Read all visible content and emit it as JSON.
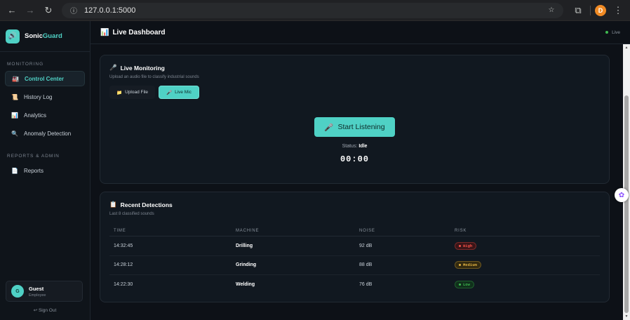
{
  "browser": {
    "url": "127.0.0.1:5000",
    "profile_initial": "D"
  },
  "sidebar": {
    "brand": {
      "name_part1": "Sonic",
      "name_part2": "Guard",
      "logo_icon": "speaker-icon"
    },
    "sections": [
      {
        "label": "MONITORING",
        "items": [
          {
            "label": "Control Center",
            "icon": "🏭",
            "active": true
          },
          {
            "label": "History Log",
            "icon": "📜",
            "active": false
          },
          {
            "label": "Analytics",
            "icon": "📊",
            "active": false
          },
          {
            "label": "Anomaly Detection",
            "icon": "🔍",
            "active": false
          }
        ]
      },
      {
        "label": "REPORTS & ADMIN",
        "items": [
          {
            "label": "Reports",
            "icon": "📄",
            "active": false
          }
        ]
      }
    ],
    "user": {
      "initial": "G",
      "name": "Guest",
      "role": "Employee"
    },
    "signout": "↩ Sign Out"
  },
  "topbar": {
    "title_icon": "📊",
    "title": "Live Dashboard",
    "live_label": "Live"
  },
  "monitor": {
    "title_icon": "🎤",
    "title": "Live Monitoring",
    "subtitle": "Upload an audio file to classify industrial sounds",
    "modes": [
      {
        "icon": "📁",
        "label": "Upload File",
        "active": false
      },
      {
        "icon": "🎤",
        "label": "Live Mic",
        "active": true
      }
    ],
    "listen_icon": "🎤",
    "listen_label": "Start Listening",
    "status_label": "Status:",
    "status_value": "Idle",
    "timer": "00:00"
  },
  "detections": {
    "title_icon": "📋",
    "title": "Recent Detections",
    "subtitle": "Last 8 classified sounds",
    "columns": [
      "TIME",
      "MACHINE",
      "NOISE",
      "RISK"
    ],
    "rows": [
      {
        "time": "14:32:45",
        "machine": "Drilling",
        "noise": "92 dB",
        "risk": "High",
        "risk_color": "#f85149",
        "risk_bg": "#3a1518"
      },
      {
        "time": "14:28:12",
        "machine": "Grinding",
        "noise": "88 dB",
        "risk": "Medium",
        "risk_color": "#e3b341",
        "risk_bg": "#332a10"
      },
      {
        "time": "14:22:30",
        "machine": "Welding",
        "noise": "76 dB",
        "risk": "Low",
        "risk_color": "#3fb950",
        "risk_bg": "#10301b"
      }
    ]
  },
  "colors": {
    "accent": "#4fd1c5",
    "background": "#0d1117",
    "card": "#111820"
  }
}
